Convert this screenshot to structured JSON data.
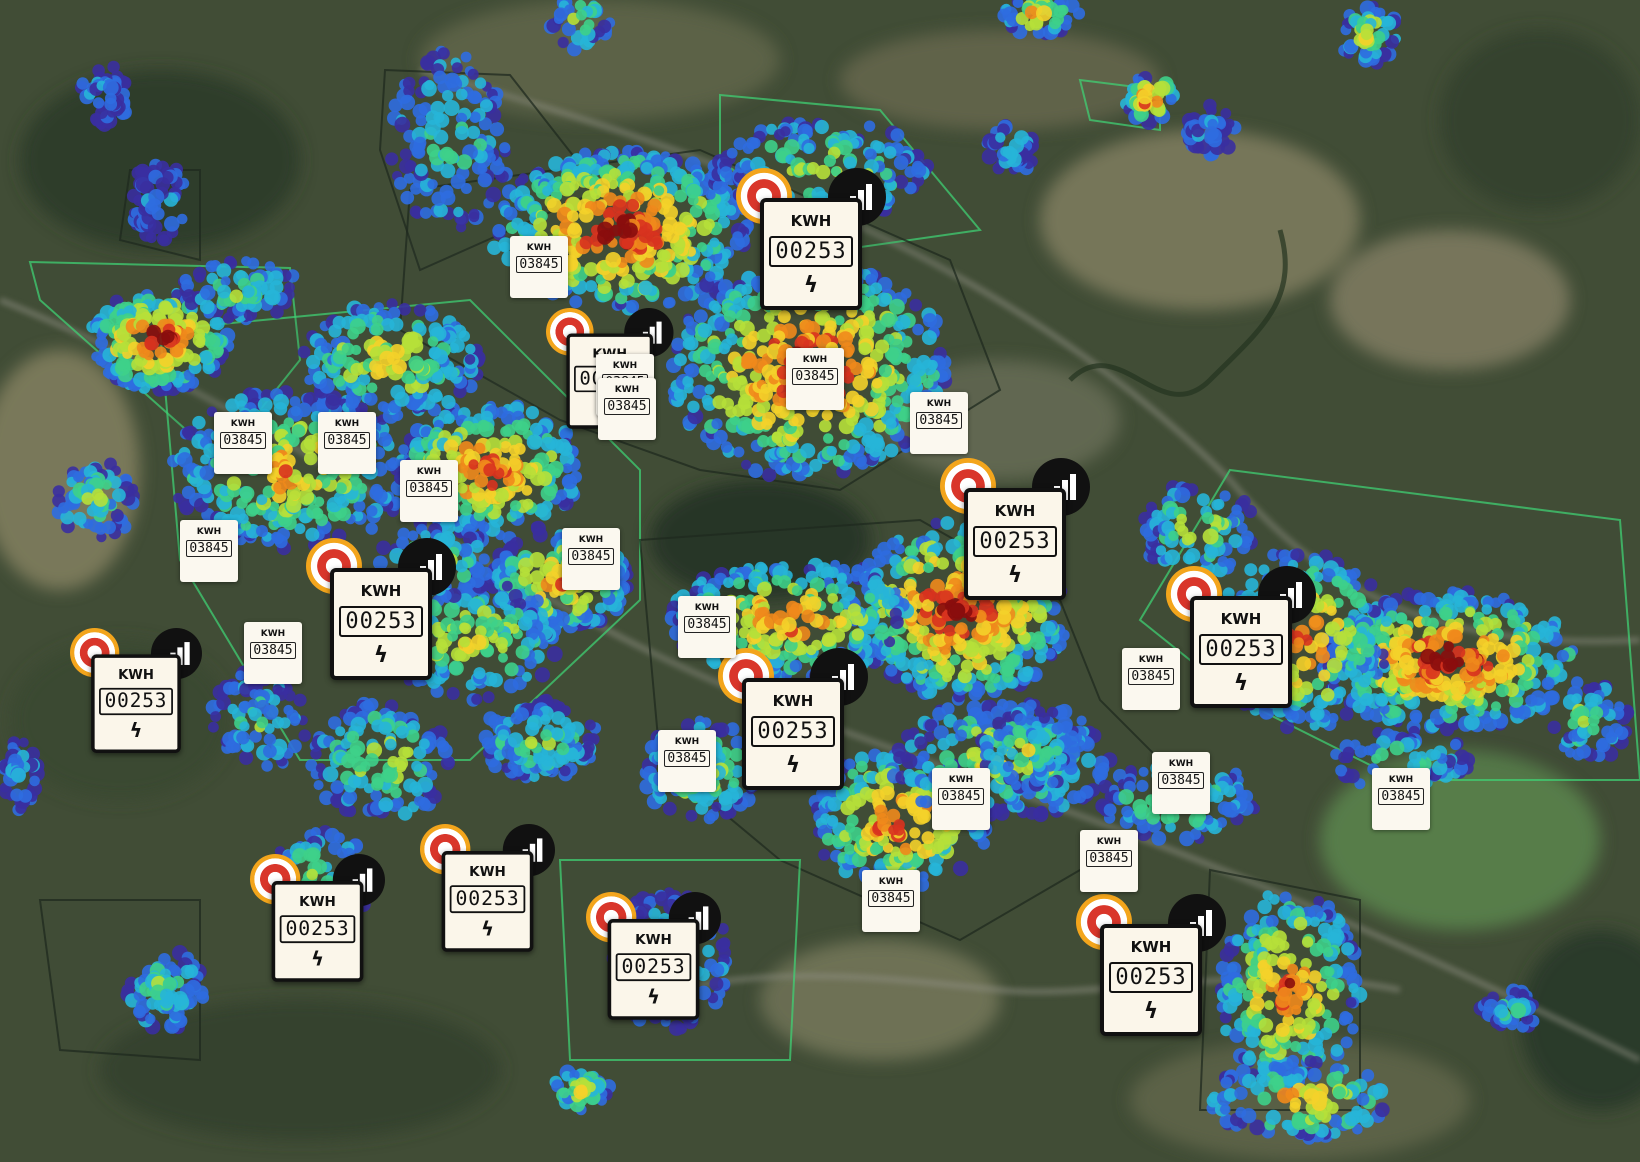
{
  "map": {
    "basemap": "satellite",
    "layers": [
      "density-heatmap",
      "cluster-boundaries",
      "smart-meters"
    ],
    "heat_colors": [
      "#3a2fa0",
      "#2f6de0",
      "#27b5d8",
      "#3ed08a",
      "#b6e03a",
      "#f4d12a",
      "#f08a1c",
      "#d8331f",
      "#8a0d0d"
    ],
    "boundary_color": "#3fcf73"
  },
  "smart_meters": {
    "unit_label": "KWH",
    "reading": "00253",
    "icon_names": [
      "target-icon",
      "signal-strength-icon",
      "lightning-bolt-icon"
    ],
    "count": 11
  },
  "meters": {
    "unit_label": "KWH",
    "reading": "03845",
    "count": 20
  }
}
